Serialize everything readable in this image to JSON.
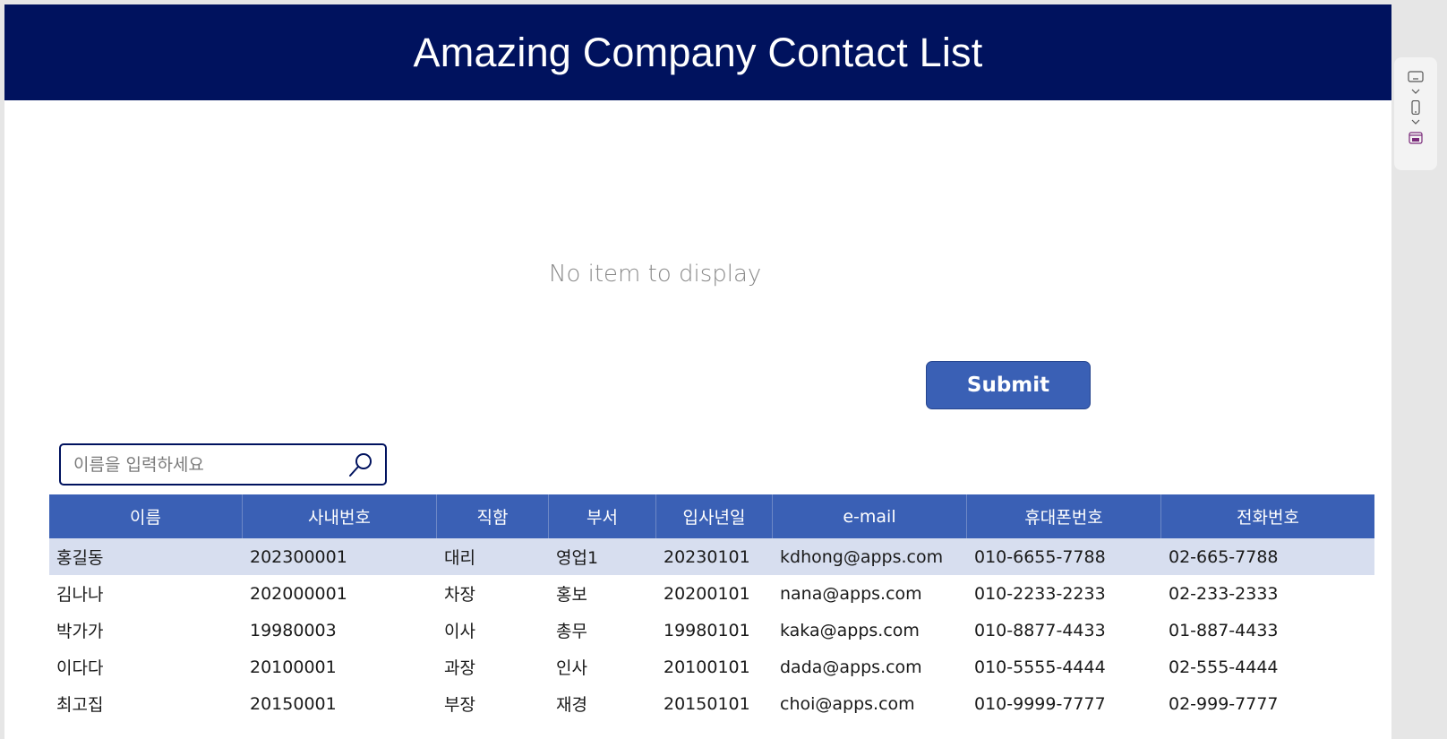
{
  "app": {
    "title": "Amazing Company Contact List",
    "accent_color": "#00125e",
    "button_color": "#3a60b5",
    "selected_row_color": "#d7deef"
  },
  "form": {
    "empty_message": "No item to display",
    "submit_label": "Submit"
  },
  "search": {
    "placeholder": "이름을 입력하세요",
    "value": "",
    "icon": "search-icon"
  },
  "table": {
    "columns": [
      "이름",
      "사내번호",
      "직함",
      "부서",
      "입사년일",
      "e-mail",
      "휴대폰번호",
      "전화번호"
    ],
    "selected_row": 0,
    "rows": [
      [
        "홍길동",
        "202300001",
        "대리",
        "영업1",
        "20230101",
        "kdhong@apps.com",
        "010-6655-7788",
        "02-665-7788"
      ],
      [
        "김나나",
        "202000001",
        "차장",
        "홍보",
        "20200101",
        "nana@apps.com",
        "010-2233-2233",
        "02-233-2333"
      ],
      [
        "박가가",
        "19980003",
        "이사",
        "총무",
        "19980101",
        "kaka@apps.com",
        "010-8877-4433",
        "01-887-4433"
      ],
      [
        "이다다",
        "20100001",
        "과장",
        "인사",
        "20100101",
        "dada@apps.com",
        "010-5555-4444",
        "02-555-4444"
      ],
      [
        "최고집",
        "20150001",
        "부장",
        "재경",
        "20150101",
        "choi@apps.com",
        "010-9999-7777",
        "02-999-7777"
      ]
    ]
  },
  "side_panel": {
    "icons": [
      "tablet-landscape-icon",
      "chevron-down-icon",
      "phone-icon",
      "chevron-down-icon",
      "calendar-icon"
    ]
  }
}
